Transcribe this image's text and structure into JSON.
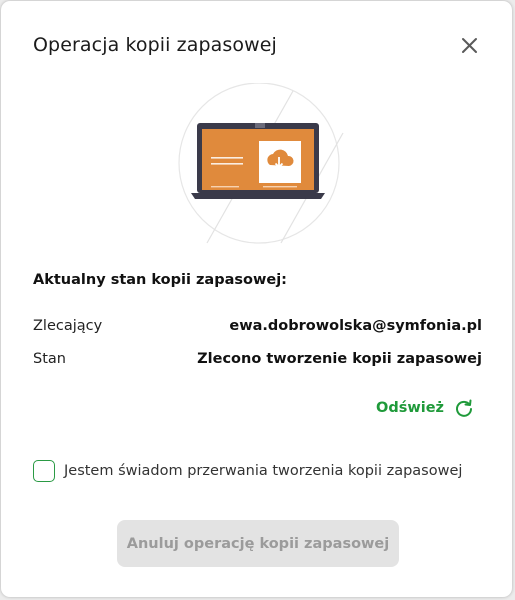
{
  "dialog": {
    "title": "Operacja kopii zapasowej",
    "close_icon": "close-icon"
  },
  "illustration": {
    "icon": "laptop-cloud-download-illustration",
    "colors": {
      "screen": "#e08a3c",
      "frame": "#3a3a4a",
      "panel": "#ffffff"
    }
  },
  "status": {
    "heading": "Aktualny stan kopii zapasowej:",
    "rows": [
      {
        "label": "Zlecający",
        "value": "ewa.dobrowolska@symfonia.pl"
      },
      {
        "label": "Stan",
        "value": "Zlecono tworzenie kopii zapasowej"
      }
    ]
  },
  "refresh": {
    "label": "Odśwież",
    "icon": "refresh-icon",
    "color": "#1f9a3a"
  },
  "confirmation": {
    "label": "Jestem świadom przerwania tworzenia kopii zapasowej",
    "checked": false
  },
  "actions": {
    "cancel_label": "Anuluj operację kopii zapasowej",
    "cancel_disabled": true
  }
}
